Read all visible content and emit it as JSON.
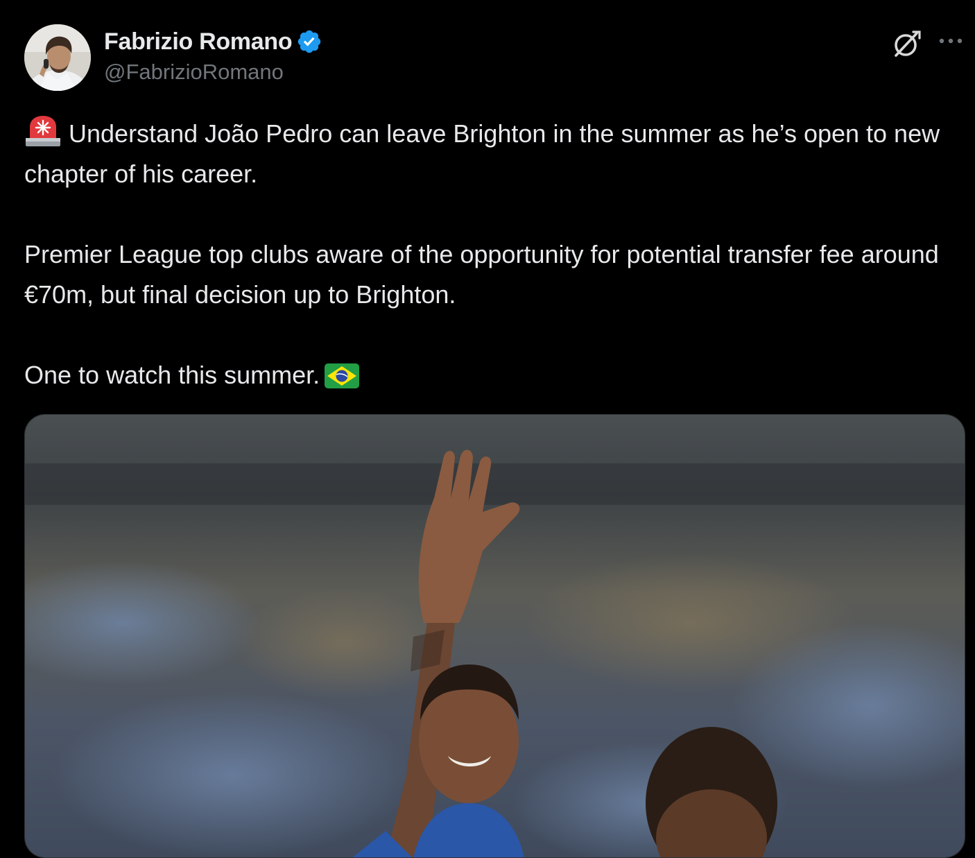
{
  "author": {
    "display_name": "Fabrizio Romano",
    "handle": "@FabrizioRomano",
    "verified": true,
    "verified_color": "#1d9bf0"
  },
  "icons": {
    "header_right": [
      "grok-icon",
      "more-options-icon"
    ],
    "inline": [
      "police-light-emoji",
      "brazil-flag-emoji"
    ]
  },
  "tweet": {
    "line1": "Understand João Pedro can leave Brighton in the summer as he’s open to new chapter of his career.",
    "line2": "Premier League top clubs aware of the opportunity for potential transfer fee around €70m, but final decision up to Brighton.",
    "line3": "One to watch this summer."
  },
  "media": {
    "kind": "photo"
  },
  "colors": {
    "background": "#000000",
    "text_primary": "#e7e9ea",
    "text_secondary": "#71767b",
    "border": "#2f3336"
  }
}
